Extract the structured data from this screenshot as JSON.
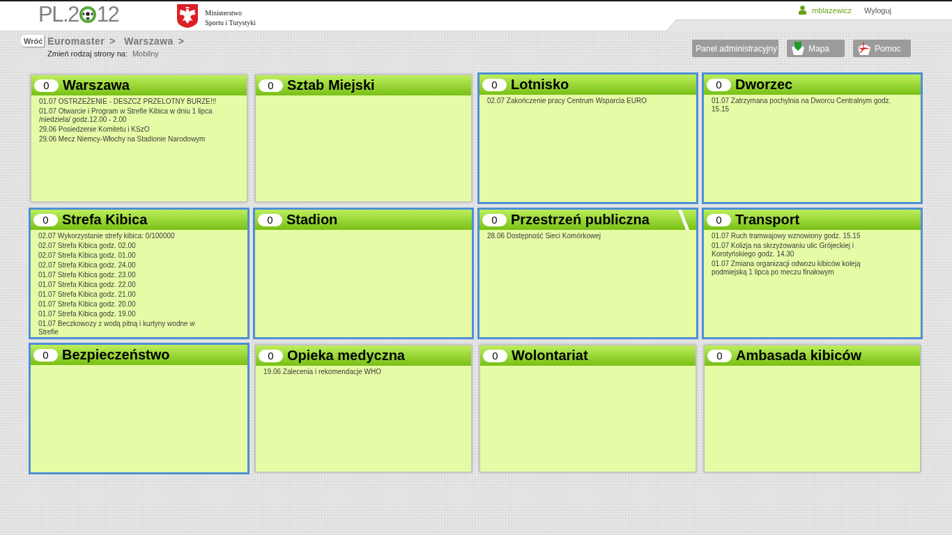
{
  "header": {
    "logo": {
      "prefix": "PL.2",
      "suffix": "12"
    },
    "ministry": [
      "Ministerstwo",
      "Sportu i Turystyki"
    ],
    "user": "mblazewicz",
    "logout": "Wyloguj"
  },
  "breadcrumb": {
    "back": "Wróć",
    "items": [
      {
        "label": "Euromaster",
        "separator": ">"
      },
      {
        "label": "Warszawa",
        "separator": ">"
      }
    ]
  },
  "view_switch": {
    "label": "Zmień rodzaj strony na:",
    "option": "Mobilny"
  },
  "toolbar": [
    {
      "label": "Panel administracyjny",
      "kind": "plain"
    },
    {
      "label": "Mapa",
      "kind": "map"
    },
    {
      "label": "Pomoc",
      "kind": "help"
    }
  ],
  "tiles": [
    {
      "title": "Warszawa",
      "count": "0",
      "alert": false,
      "corner_mark": false,
      "items": [
        "01.07 OSTRZEŻENIE - DESZCZ PRZELOTNY BURZE!!!",
        "01.07 Otwarcie i Program w Strefie Kibica w dniu 1 lipca\n/niedziela/ godz.12.00 - 2.00",
        "29.06 Posiedzenie Komitetu i KSzO",
        "29.06 Mecz Niemcy-Włochy na Stadionie Narodowym"
      ]
    },
    {
      "title": "Sztab Miejski",
      "count": "0",
      "alert": false,
      "corner_mark": false
    },
    {
      "title": "Lotnisko",
      "count": "0",
      "alert": true,
      "corner_mark": false,
      "items": [
        "02.07 Zakończenie pracy Centrum Wsparcia EURO"
      ]
    },
    {
      "title": "Dworzec",
      "count": "0",
      "alert": true,
      "corner_mark": false,
      "items": [
        "01.07 Zatrzymana pochylnia na Dworcu Centralnym godz.\n15.15"
      ]
    },
    {
      "title": "Strefa Kibica",
      "count": "0",
      "alert": true,
      "corner_mark": false,
      "items": [
        "02.07 Wykorzystanie strefy kibica: 0/100000",
        "02.07 Strefa Kibica godz. 02.00",
        "02.07 Strefa Kibica godz. 01.00",
        "02.07 Strefa Kibica godz. 24.00",
        "01.07 Strefa Kibica godz. 23.00",
        "01.07 Strefa Kibica godz. 22.00",
        "01.07 Strefa Kibica godz. 21.00",
        "01.07 Strefa Kibica godz. 20.00",
        "01.07 Strefa Kibica godz. 19.00",
        "01.07 Beczkowozy z wodą pitną i kurtyny wodne w\nStrefie"
      ]
    },
    {
      "title": "Stadion",
      "count": "0",
      "alert": true,
      "corner_mark": false
    },
    {
      "title": "Przestrzeń publiczna",
      "count": "0",
      "alert": true,
      "corner_mark": true,
      "items": [
        "28.06 Dostępność Sieci Komórkowej"
      ]
    },
    {
      "title": "Transport",
      "count": "0",
      "alert": true,
      "corner_mark": false,
      "items": [
        "01.07 Ruch tramwajowy wznowiony godz. 15.15",
        "01.07 Kolizja na skrzyżowaniu ulic Grójeckiej i\nKorotyńskiego godz. 14.30",
        "01.07 Zmiana organizacji odwozu kibiców koleją\npodmiejską 1 lipca po meczu finałowym"
      ]
    },
    {
      "title": "Bezpieczeństwo",
      "count": "0",
      "alert": true,
      "corner_mark": false
    },
    {
      "title": "Opieka medyczna",
      "count": "0",
      "alert": false,
      "corner_mark": false,
      "items": [
        "19.06 Zalecenia i rekomendacje WHO"
      ]
    },
    {
      "title": "Wolontariat",
      "count": "0",
      "alert": false,
      "corner_mark": false
    },
    {
      "title": "Ambasada kibiców",
      "count": "0",
      "alert": false,
      "corner_mark": false
    }
  ]
}
